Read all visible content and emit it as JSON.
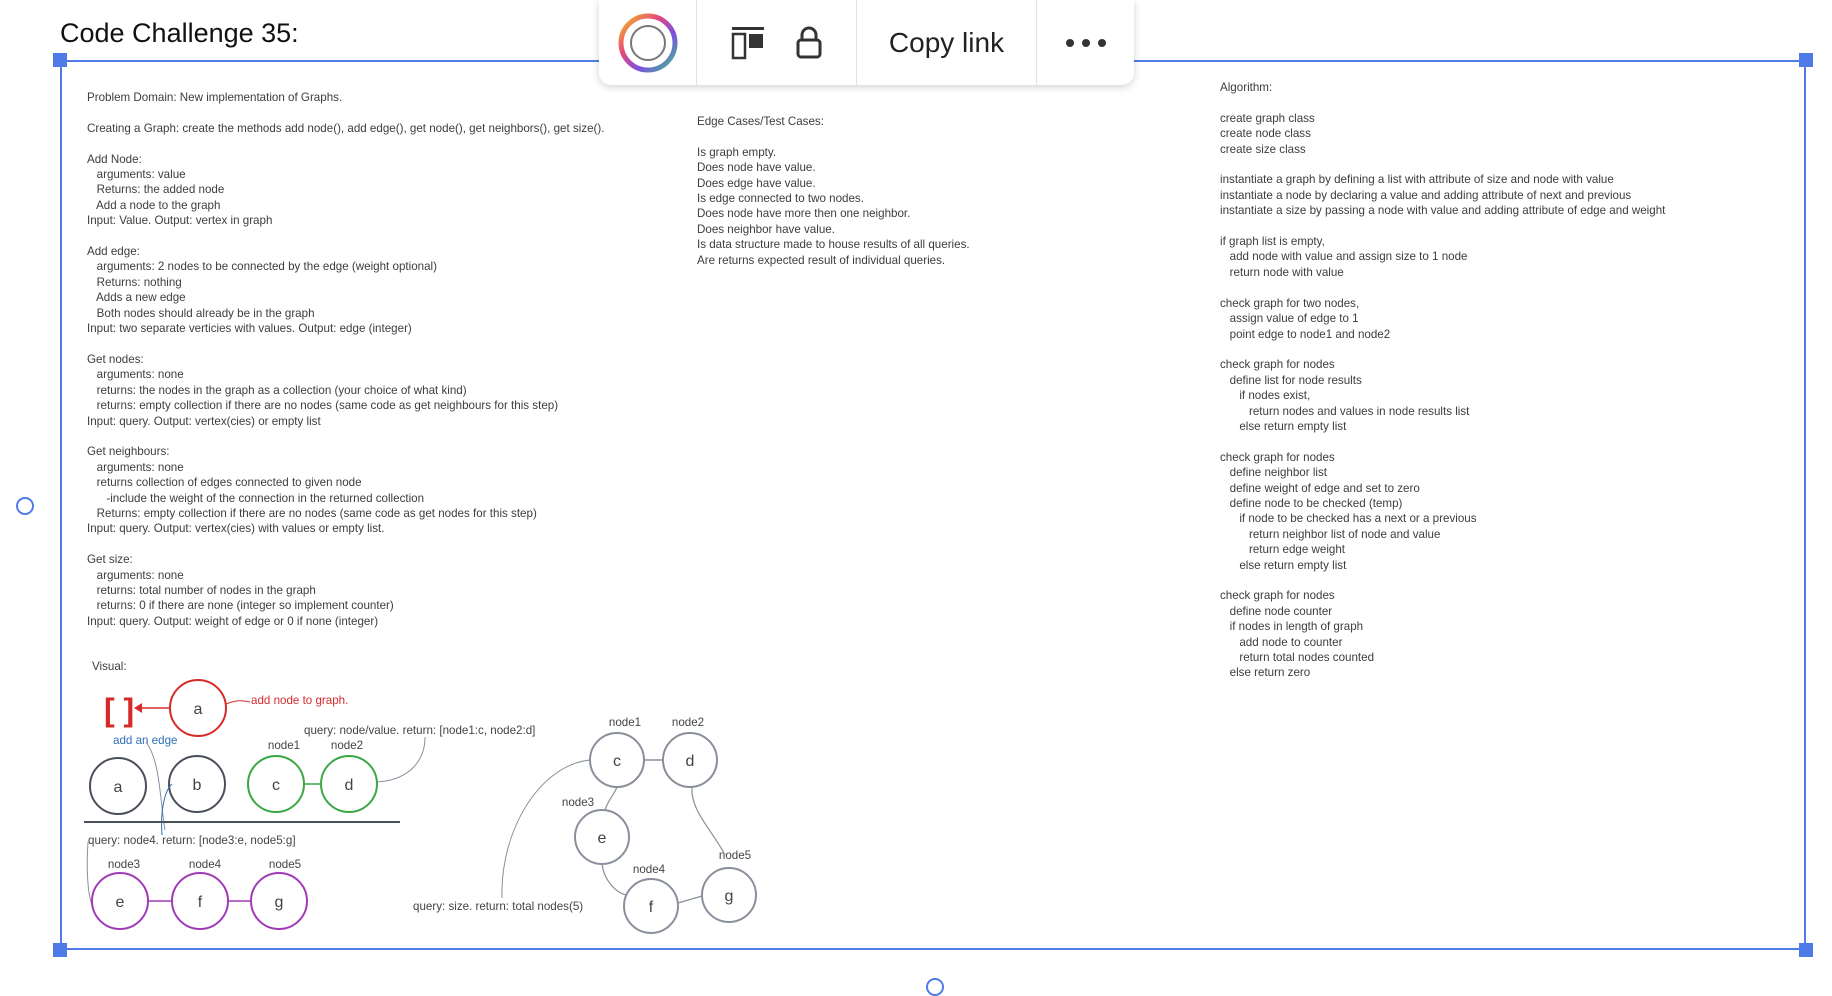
{
  "title": "Code Challenge 35:",
  "toolbar": {
    "copy_link": "Copy link",
    "more": "•••"
  },
  "problem_text": "Problem Domain: New implementation of Graphs.\n\nCreating a Graph: create the methods add node(), add edge(), get node(), get neighbors(), get size().\n\nAdd Node:\n   arguments: value\n   Returns: the added node\n   Add a node to the graph\nInput: Value. Output: vertex in graph\n\nAdd edge:\n   arguments: 2 nodes to be connected by the edge (weight optional)\n   Returns: nothing\n   Adds a new edge\n   Both nodes should already be in the graph\nInput: two separate verticies with values. Output: edge (integer)\n\nGet nodes:\n   arguments: none\n   returns: the nodes in the graph as a collection (your choice of what kind)\n   returns: empty collection if there are no nodes (same code as get neighbours for this step)\nInput: query. Output: vertex(cies) or empty list\n\nGet neighbours:\n   arguments: none\n   returns collection of edges connected to given node\n      -include the weight of the connection in the returned collection\n   Returns: empty collection if there are no nodes (same code as get nodes for this step)\nInput: query. Output: vertex(cies) with values or empty list.\n\nGet size:\n   arguments: none\n   returns: total number of nodes in the graph\n   returns: 0 if there are none (integer so implement counter)\nInput: query. Output: weight of edge or 0 if none (integer)",
  "edge_cases_text": "Edge Cases/Test Cases:\n\nIs graph empty.\nDoes node have value.\nDoes edge have value.\nIs edge connected to two nodes.\nDoes node have more then one neighbor.\nDoes neighbor have value.\nIs data structure made to house results of all queries.\nAre returns expected result of individual queries.",
  "algorithm_text": "Algorithm:\n\ncreate graph class\ncreate node class\ncreate size class\n\ninstantiate a graph by defining a list with attribute of size and node with value\ninstantiate a node by declaring a value and adding attribute of next and previous\ninstantiate a size by passing a node with value and adding attribute of edge and weight\n\nif graph list is empty,\n   add node with value and assign size to 1 node\n   return node with value\n\ncheck graph for two nodes,\n   assign value of edge to 1\n   point edge to node1 and node2\n\ncheck graph for nodes\n   define list for node results\n      if nodes exist,\n         return nodes and values in node results list\n      else return empty list\n\ncheck graph for nodes\n   define neighbor list\n   define weight of edge and set to zero\n   define node to be checked (temp)\n      if node to be checked has a next or a previous\n         return neighbor list of node and value\n         return edge weight\n      else return empty list\n\ncheck graph for nodes\n   define node counter\n   if nodes in length of graph\n      add node to counter\n      return total nodes counted\n   else return zero",
  "visual": {
    "label": "Visual:",
    "empty_list": "[ ]",
    "add_node_caption": "add node to graph.",
    "add_edge_caption": "add an edge",
    "query_node_value": "query: node/value. return: [node1:c, node2:d]",
    "query_node4": "query: node4. return: [node3:e, node5:g]",
    "query_size": "query: size. return: total nodes(5)",
    "node_letters": {
      "a": "a",
      "b": "b",
      "c": "c",
      "d": "d",
      "e": "e",
      "f": "f",
      "g": "g"
    },
    "node_names": {
      "node1": "node1",
      "node2": "node2",
      "node3": "node3",
      "node4": "node4",
      "node5": "node5"
    },
    "colors": {
      "red": "#d62a2a",
      "blue": "#2f6fb5",
      "green": "#3aa845",
      "purple": "#a23ab8",
      "gray": "#8a8f9c",
      "dark": "#4a4f5c"
    }
  }
}
